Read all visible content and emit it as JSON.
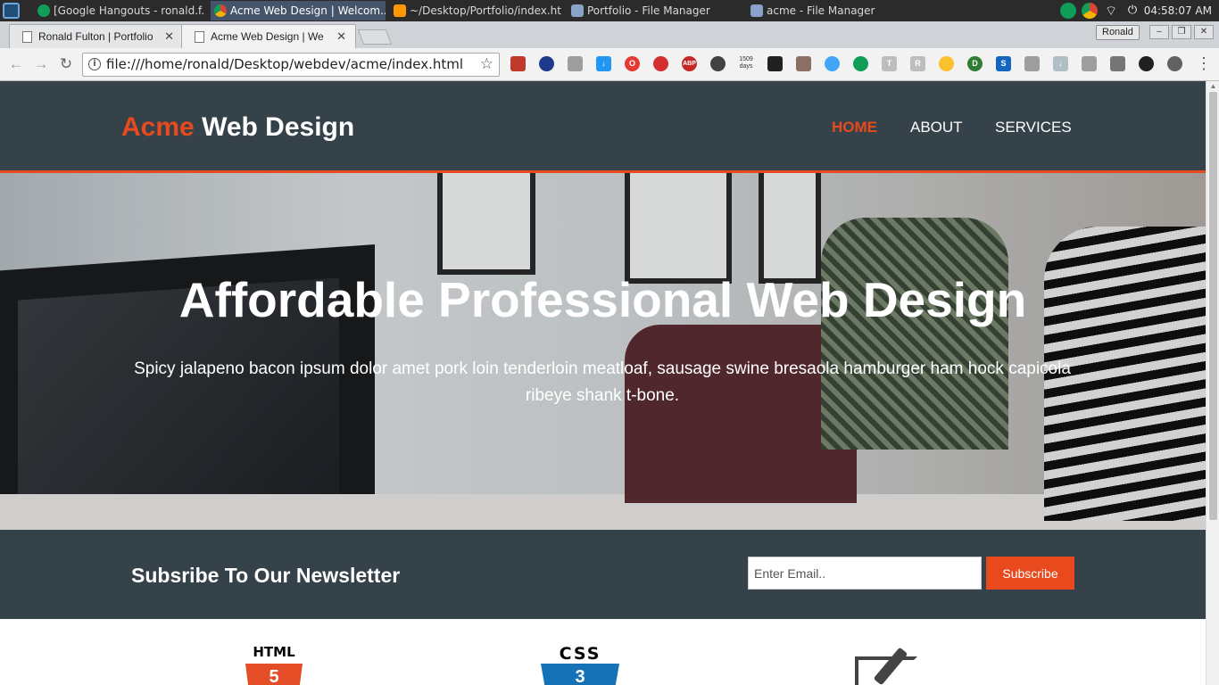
{
  "taskbar": {
    "tasks": [
      {
        "label": "[Google Hangouts - ronald.f..."
      },
      {
        "label": "Acme Web Design | Welcom..."
      },
      {
        "label": "~/Desktop/Portfolio/index.ht..."
      },
      {
        "label": "Portfolio - File Manager"
      },
      {
        "label": "acme - File Manager"
      }
    ],
    "clock": "04:58:07 AM"
  },
  "browser": {
    "tabs": [
      {
        "label": "Ronald Fulton | Portfolio"
      },
      {
        "label": "Acme Web Design | We"
      }
    ],
    "profile": "Ronald",
    "url": "file:///home/ronald/Desktop/webdev/acme/index.html",
    "extension_counter": "1509 days"
  },
  "site": {
    "brand_highlight": "Acme",
    "brand_rest": "Web Design",
    "nav": [
      {
        "label": "Home"
      },
      {
        "label": "About"
      },
      {
        "label": "Services"
      }
    ],
    "showcase_title": "Affordable Professional Web Design",
    "showcase_text": "Spicy jalapeno bacon ipsum dolor amet pork loin tenderloin meatloaf, sausage swine bresaola hamburger ham hock capicola ribeye shank t-bone.",
    "newsletter_title": "Subsribe To Our Newsletter",
    "email_placeholder": "Enter Email..",
    "subscribe_label": "Subscribe",
    "logos": [
      {
        "word": "HTML",
        "badge": "5"
      },
      {
        "word": "CSS",
        "badge": "3"
      }
    ]
  },
  "colors": {
    "header": "#35424a",
    "accent": "#e8491d"
  }
}
